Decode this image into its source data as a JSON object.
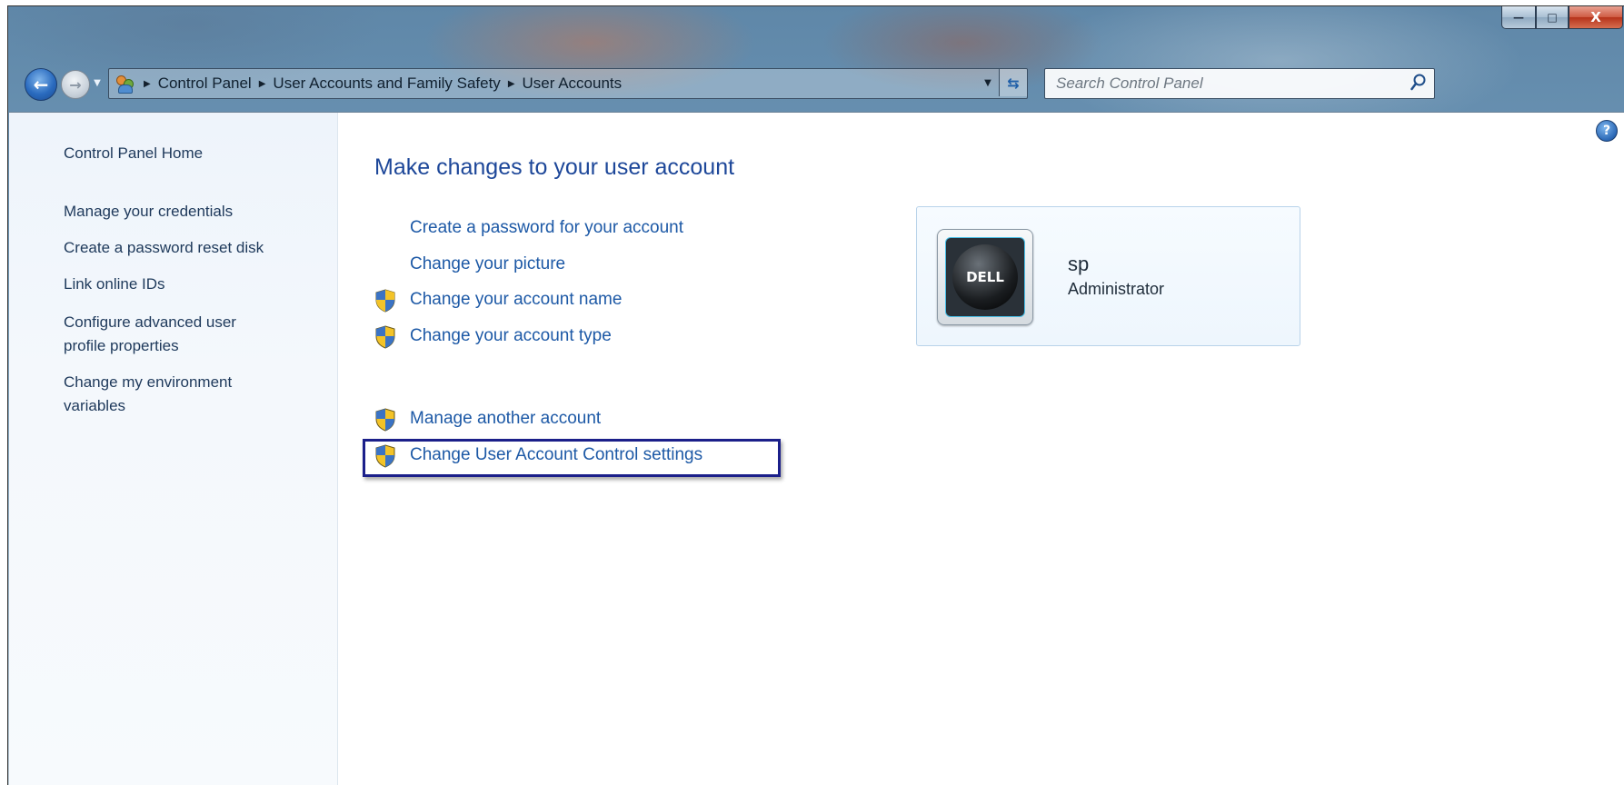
{
  "caption_buttons": {
    "minimize": "—",
    "maximize": "□",
    "close": "X"
  },
  "nav": {
    "back_glyph": "←",
    "forward_glyph": "→",
    "history_glyph": "▼",
    "breadcrumb": [
      "Control Panel",
      "User Accounts and Family Safety",
      "User Accounts"
    ],
    "crumb_separator": "▶",
    "dropdown_glyph": "▼",
    "refresh_glyph": "⇆"
  },
  "search": {
    "placeholder": "Search Control Panel"
  },
  "sidebar": {
    "items": [
      {
        "label": "Control Panel Home"
      },
      {
        "label": "Manage your credentials"
      },
      {
        "label": "Create a password reset disk"
      },
      {
        "label": "Link online IDs"
      },
      {
        "label": "Configure advanced user"
      },
      {
        "label": "profile properties"
      },
      {
        "label": "Change my environment"
      },
      {
        "label": "variables"
      }
    ]
  },
  "main": {
    "title": "Make changes to your user account",
    "tasks": [
      {
        "label": "Create a password for your account",
        "shield": false
      },
      {
        "label": "Change your picture",
        "shield": false
      },
      {
        "label": "Change your account name",
        "shield": true
      },
      {
        "label": "Change your account type",
        "shield": true
      },
      {
        "label": "Manage another account",
        "shield": true
      },
      {
        "label": "Change User Account Control settings",
        "shield": true
      }
    ]
  },
  "account": {
    "name": "sp",
    "role": "Administrator",
    "avatar_text": "DELL"
  },
  "help_glyph": "?",
  "colors": {
    "link": "#1d59a6",
    "title": "#1d4799",
    "highlight_border": "#1b1f8a",
    "sidebar_link": "#1e395b"
  }
}
